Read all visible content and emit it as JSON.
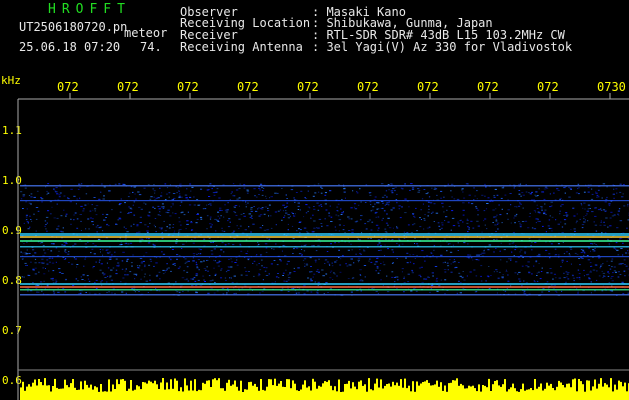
{
  "app_title": "HROFFT",
  "file_name": "UT2506180720.pn",
  "detector_label": "meteor",
  "datetime": "25.06.18 07:20",
  "count": "74.",
  "info": {
    "labels": [
      "Observer",
      "Receiving Location",
      "Receiver",
      "Receiving Antenna"
    ],
    "values": [
      ": Masaki Kano",
      ": Shibukawa, Gunma, Japan",
      ": RTL-SDR SDR# 43dB L15 103.2MHz CW",
      ": 3el Yagi(V) Az 330 for Vladivostok"
    ]
  },
  "unit_label": "kHz",
  "time_ticks": [
    "072",
    "072",
    "072",
    "072",
    "072",
    "072",
    "072",
    "072",
    "072",
    "0730"
  ],
  "freq_ticks": [
    "1.1",
    "1.0",
    "0.9",
    "0.8",
    "0.7",
    "0.6"
  ],
  "colors": {
    "background": "#000000",
    "title_green": "#22dd22",
    "tick_yellow": "#ffff00",
    "text_white": "#e8e8e8",
    "spectrum_blue": "#1830ff"
  }
}
